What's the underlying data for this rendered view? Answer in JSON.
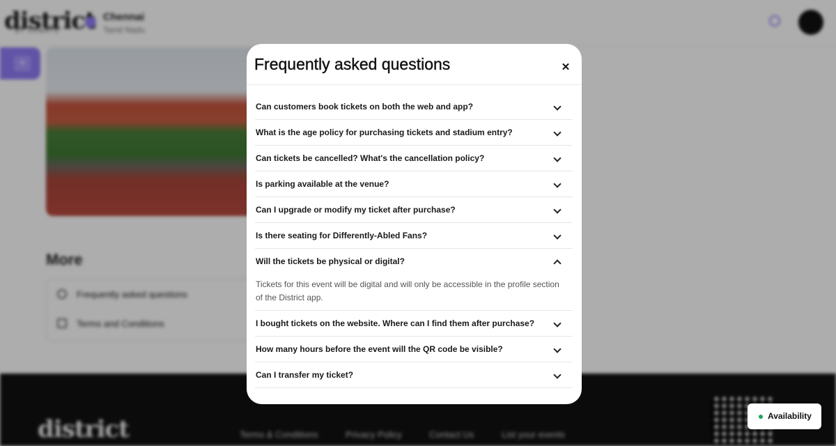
{
  "header": {
    "logo": "district",
    "logo_sub": "BY ZOMATO",
    "city": "Chennai",
    "state": "Tamil Nadu"
  },
  "more": {
    "heading": "More",
    "items": [
      "Frequently asked questions",
      "Terms and Conditions"
    ]
  },
  "footer": {
    "logo": "district",
    "links": [
      "Terms & Conditions",
      "Privacy Policy",
      "Contact Us",
      "List your events"
    ]
  },
  "modal": {
    "title": "Frequently asked questions",
    "close_icon": "close-icon",
    "faqs": [
      {
        "q": "Can customers book tickets on both the web and app?",
        "expanded": false
      },
      {
        "q": "What is the age policy for purchasing tickets and stadium entry?",
        "expanded": false
      },
      {
        "q": "Can tickets be cancelled? What's the cancellation policy?",
        "expanded": false
      },
      {
        "q": "Is parking available at the venue?",
        "expanded": false
      },
      {
        "q": "Can I upgrade or modify my ticket after purchase?",
        "expanded": false
      },
      {
        "q": "Is there seating for Differently-Abled Fans?",
        "expanded": false
      },
      {
        "q": "Will the tickets be physical or digital?",
        "expanded": true,
        "a": "Tickets for this event will be digital and will only be accessible in the profile section of the District app."
      },
      {
        "q": "I bought tickets on the website. Where can I find them after purchase?",
        "expanded": false
      },
      {
        "q": "How many hours before the event will the QR code be visible?",
        "expanded": false
      },
      {
        "q": "Can I transfer my ticket?",
        "expanded": false
      }
    ]
  },
  "availability": {
    "label": "Availability",
    "dot_color": "#22a35a"
  },
  "colors": {
    "accent": "#8f7cf7",
    "overlay": "rgba(0,0,0,0.32)"
  }
}
